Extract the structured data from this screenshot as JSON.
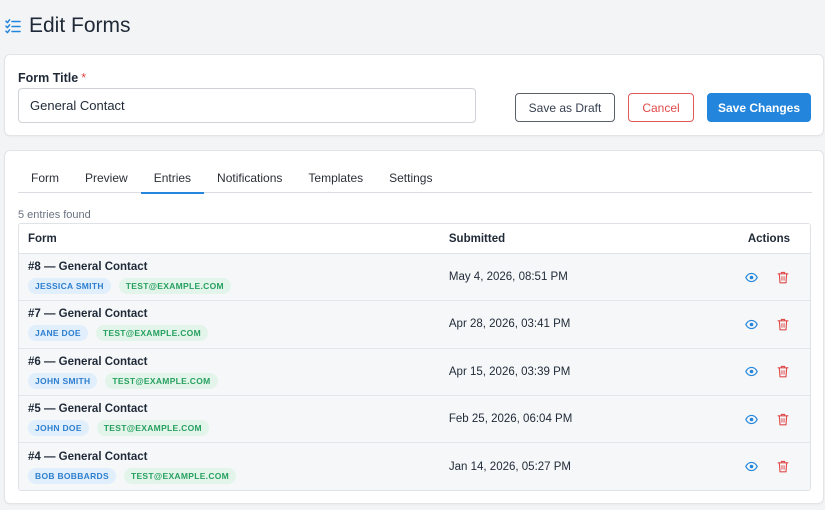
{
  "header": {
    "title": "Edit Forms",
    "icon": "checklist-icon"
  },
  "title_card": {
    "label": "Form Title",
    "required_mark": "*",
    "value": "General Contact",
    "buttons": {
      "draft": "Save as Draft",
      "cancel": "Cancel",
      "save": "Save Changes"
    }
  },
  "tabs": [
    {
      "label": "Form"
    },
    {
      "label": "Preview"
    },
    {
      "label": "Entries",
      "active": true
    },
    {
      "label": "Notifications"
    },
    {
      "label": "Templates"
    },
    {
      "label": "Settings"
    }
  ],
  "entries": {
    "count_text": "5 entries found",
    "columns": {
      "form": "Form",
      "submitted": "Submitted",
      "actions": "Actions"
    },
    "rows": [
      {
        "title": "#8 — General Contact",
        "name": "JESSICA SMITH",
        "email": "TEST@EXAMPLE.COM",
        "submitted": "May 4, 2026, 08:51 PM"
      },
      {
        "title": "#7 — General Contact",
        "name": "JANE DOE",
        "email": "TEST@EXAMPLE.COM",
        "submitted": "Apr 28, 2026, 03:41 PM"
      },
      {
        "title": "#6 — General Contact",
        "name": "JOHN SMITH",
        "email": "TEST@EXAMPLE.COM",
        "submitted": "Apr 15, 2026, 03:39 PM"
      },
      {
        "title": "#5 — General Contact",
        "name": "JOHN DOE",
        "email": "TEST@EXAMPLE.COM",
        "submitted": "Feb 25, 2026, 06:04 PM"
      },
      {
        "title": "#4 — General Contact",
        "name": "BOB BOBBARDS",
        "email": "TEST@EXAMPLE.COM",
        "submitted": "Jan 14, 2026, 05:27 PM"
      }
    ]
  },
  "colors": {
    "accent": "#2386dc",
    "danger": "#e04a4a",
    "success": "#27a060"
  }
}
